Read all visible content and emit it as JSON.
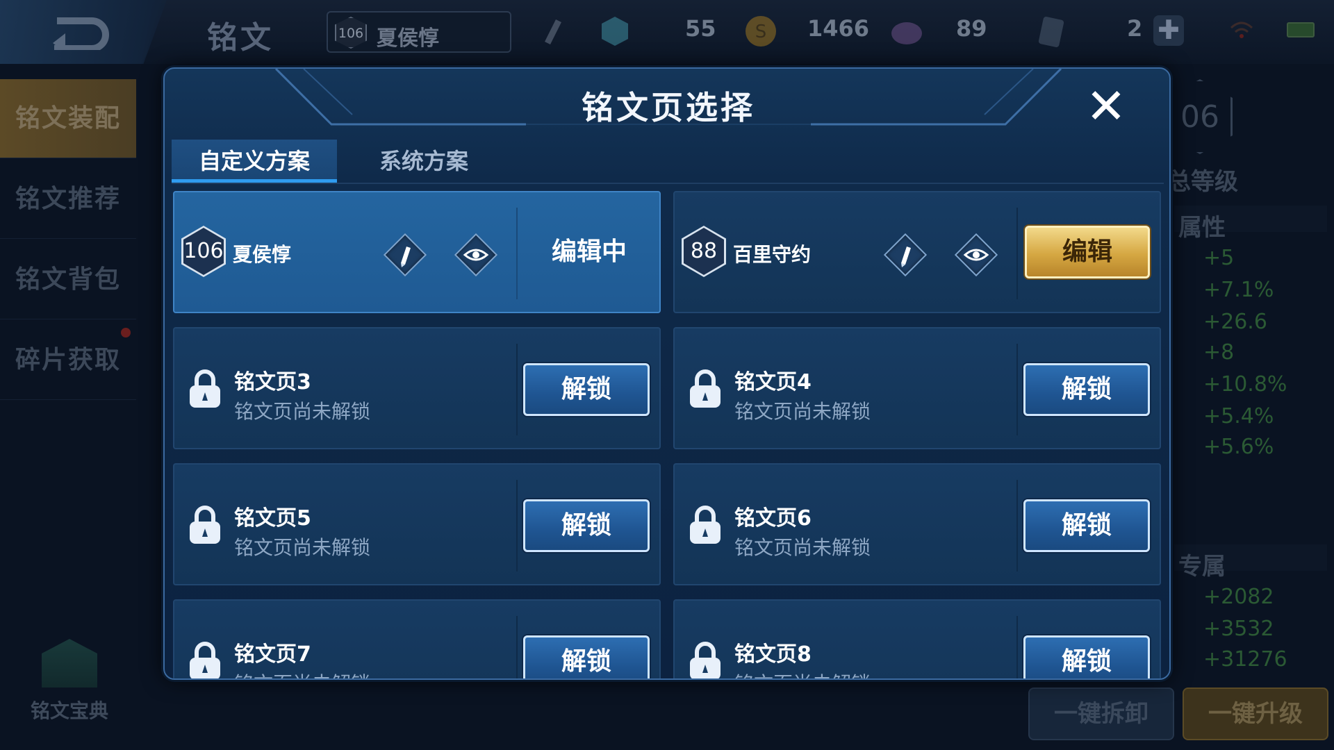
{
  "topbar": {
    "title": "铭文",
    "hero_level": "106",
    "hero_name": "夏侯惇",
    "resources": [
      {
        "icon": "crystal-icon",
        "value": "55"
      },
      {
        "icon": "gold-coin-icon",
        "value": "1466"
      },
      {
        "icon": "gem-icon",
        "value": "89"
      },
      {
        "icon": "coupon-icon",
        "value": "2"
      }
    ],
    "plus": "✚"
  },
  "leftnav": {
    "items": [
      "铭文装配",
      "铭文推荐",
      "铭文背包",
      "碎片获取"
    ],
    "codex": "铭文宝典"
  },
  "rightpanel": {
    "level_text": "06",
    "total_level": "总等级",
    "attr_title": "属性",
    "stats": [
      "+5",
      "+7.1%",
      "+26.6",
      "+8",
      "+10.8%",
      "+5.4%",
      "+5.6%"
    ],
    "exclusive_title": "专属",
    "exclusive_stats": [
      "+2082",
      "+3532",
      "+31276"
    ],
    "dismantle": "一键拆卸",
    "upgrade": "一键升级"
  },
  "modal": {
    "title": "铭文页选择",
    "close": "✕",
    "tabs": [
      "自定义方案",
      "系统方案"
    ],
    "active_pages": [
      {
        "level": "106",
        "hero": "夏侯惇",
        "status": "编辑中"
      },
      {
        "level": "88",
        "hero": "百里守约",
        "action": "编辑"
      }
    ],
    "locked_pages": [
      {
        "name": "铭文页3",
        "sub": "铭文页尚未解锁",
        "action": "解锁"
      },
      {
        "name": "铭文页4",
        "sub": "铭文页尚未解锁",
        "action": "解锁"
      },
      {
        "name": "铭文页5",
        "sub": "铭文页尚未解锁",
        "action": "解锁"
      },
      {
        "name": "铭文页6",
        "sub": "铭文页尚未解锁",
        "action": "解锁"
      },
      {
        "name": "铭文页7",
        "sub": "铭文页尚未解锁",
        "action": "解锁"
      },
      {
        "name": "铭文页8",
        "sub": "铭文页尚未解锁",
        "action": "解锁"
      }
    ]
  },
  "colors": {
    "accent_blue": "#2f9cf0",
    "gold_button": "#d5a742",
    "modal_bg": "#0f2a4a"
  }
}
